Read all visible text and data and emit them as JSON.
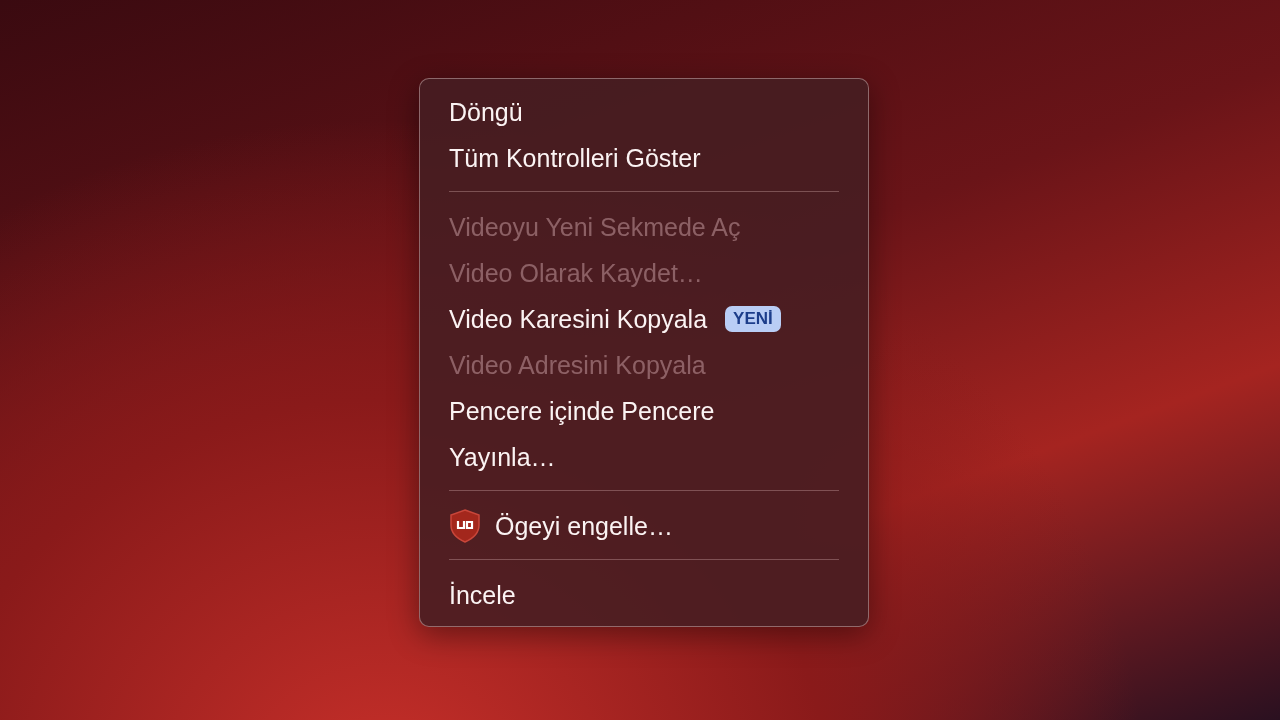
{
  "context_menu": {
    "sections": [
      {
        "items": [
          {
            "kind": "plain",
            "label": "Döngü",
            "disabled": false
          },
          {
            "kind": "plain",
            "label": "Tüm Kontrolleri Göster",
            "disabled": false
          }
        ]
      },
      {
        "items": [
          {
            "kind": "plain",
            "label": "Videoyu Yeni Sekmede Aç",
            "disabled": true
          },
          {
            "kind": "plain",
            "label": "Video Olarak Kaydet…",
            "disabled": true
          },
          {
            "kind": "plain",
            "label": "Video Karesini Kopyala",
            "disabled": false,
            "badge": "YENİ"
          },
          {
            "kind": "plain",
            "label": "Video Adresini Kopyala",
            "disabled": true
          },
          {
            "kind": "plain",
            "label": "Pencere içinde Pencere",
            "disabled": false
          },
          {
            "kind": "plain",
            "label": "Yayınla…",
            "disabled": false
          }
        ]
      },
      {
        "items": [
          {
            "kind": "extension",
            "label": "Ögeyi engelle…",
            "disabled": false
          }
        ]
      },
      {
        "items": [
          {
            "kind": "plain",
            "label": "İncele",
            "disabled": false
          }
        ]
      }
    ]
  }
}
